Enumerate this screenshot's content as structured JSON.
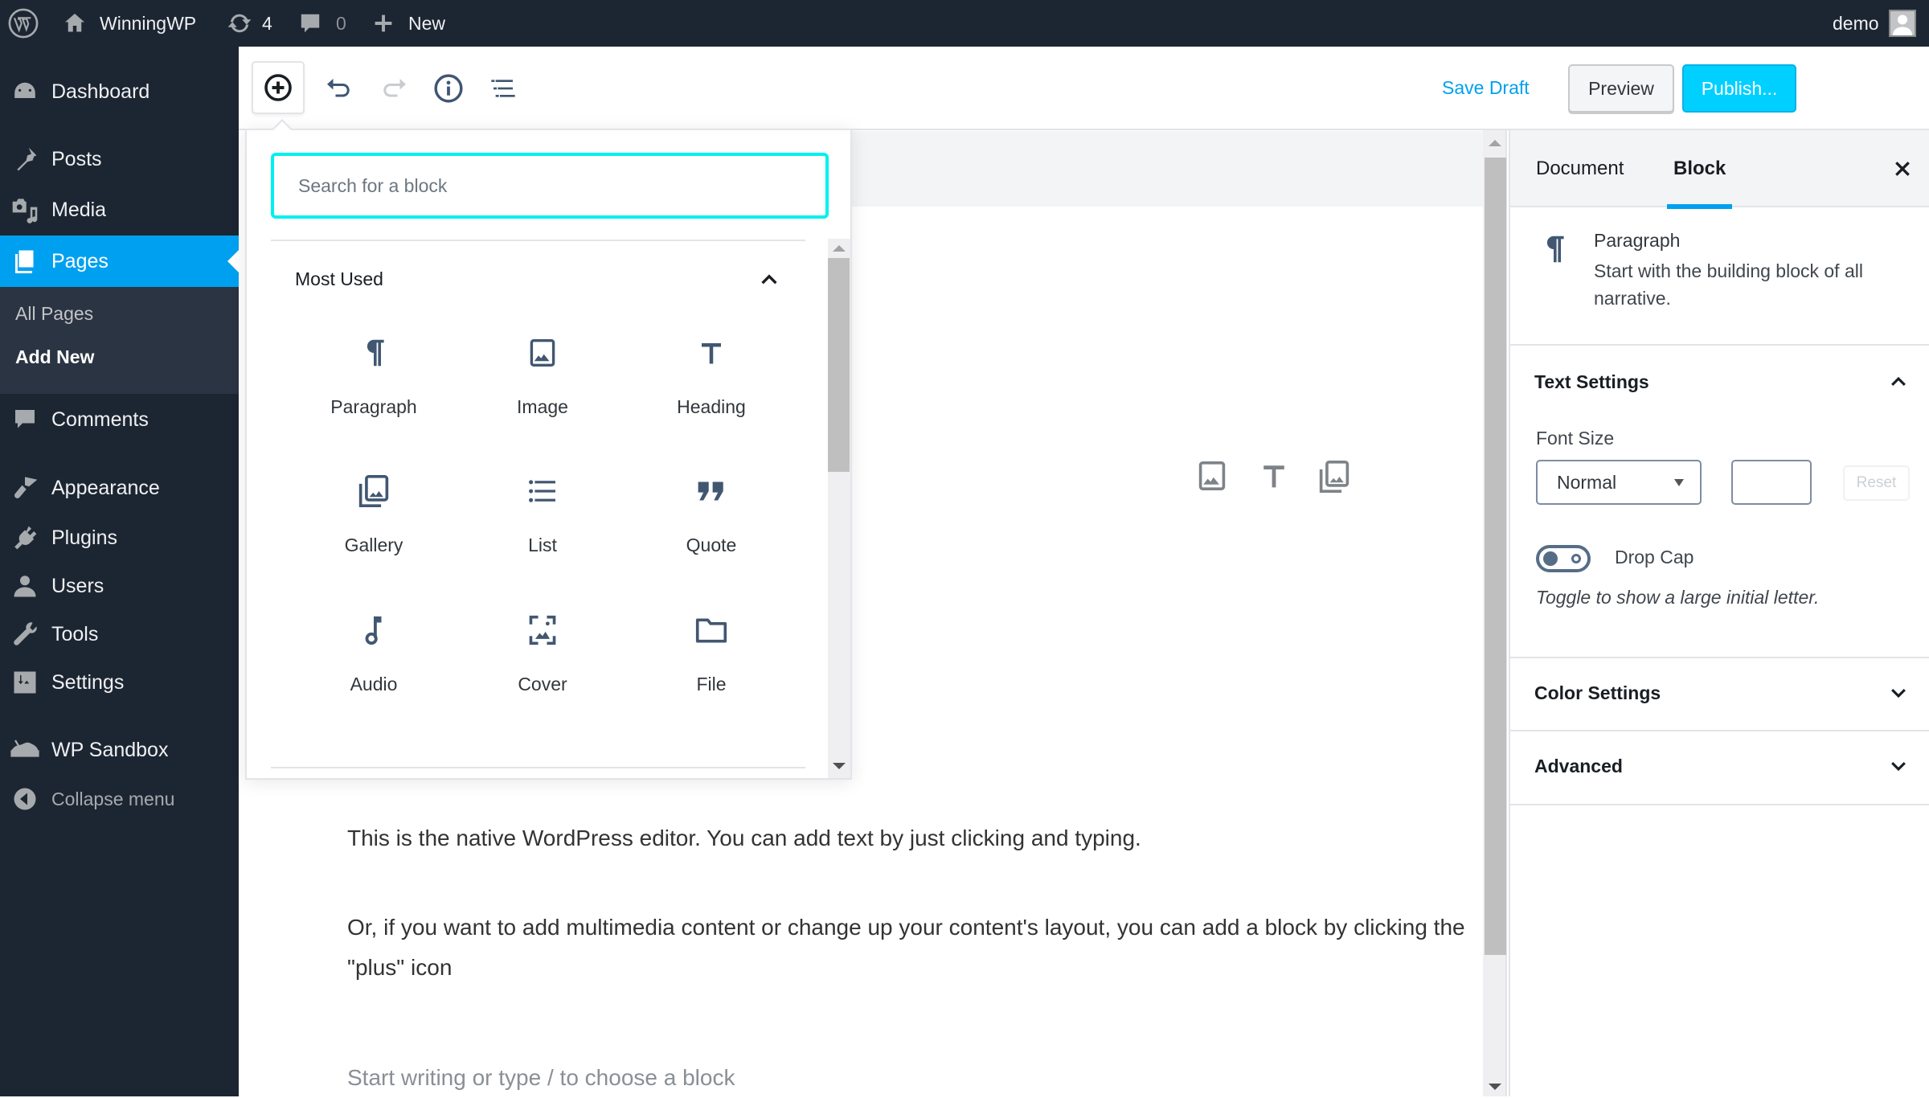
{
  "admin_bar": {
    "site_name": "WinningWP",
    "updates_count": "4",
    "comments_count": "0",
    "new_label": "New",
    "user_name": "demo"
  },
  "admin_menu": {
    "items": [
      {
        "label": "Dashboard",
        "icon": "dashboard-icon"
      },
      {
        "label": "Posts",
        "icon": "pin-icon"
      },
      {
        "label": "Media",
        "icon": "media-icon"
      },
      {
        "label": "Pages",
        "icon": "pages-icon",
        "active": true
      },
      {
        "label": "Comments",
        "icon": "comment-icon"
      },
      {
        "label": "Appearance",
        "icon": "paintbrush-icon"
      },
      {
        "label": "Plugins",
        "icon": "plugin-icon"
      },
      {
        "label": "Users",
        "icon": "user-icon"
      },
      {
        "label": "Tools",
        "icon": "wrench-icon"
      },
      {
        "label": "Settings",
        "icon": "settings-sliders-icon"
      },
      {
        "label": "WP Sandbox",
        "icon": "sandbox-icon"
      },
      {
        "label": "Collapse menu",
        "icon": "collapse-icon"
      }
    ],
    "submenu": [
      {
        "label": "All Pages"
      },
      {
        "label": "Add New",
        "current": true
      }
    ]
  },
  "toolbar": {
    "save_draft_label": "Save Draft",
    "preview_label": "Preview",
    "publish_label": "Publish...",
    "icons": [
      "add-block-icon",
      "undo-icon",
      "redo-icon",
      "info-icon",
      "outline-icon",
      "gear-icon",
      "more-vertical-icon"
    ]
  },
  "inserter": {
    "search_placeholder": "Search for a block",
    "category_label": "Most Used",
    "blocks": [
      {
        "label": "Paragraph",
        "icon": "paragraph-icon"
      },
      {
        "label": "Image",
        "icon": "image-icon"
      },
      {
        "label": "Heading",
        "icon": "heading-icon"
      },
      {
        "label": "Gallery",
        "icon": "gallery-icon"
      },
      {
        "label": "List",
        "icon": "list-icon"
      },
      {
        "label": "Quote",
        "icon": "quote-icon"
      },
      {
        "label": "Audio",
        "icon": "audio-icon"
      },
      {
        "label": "Cover",
        "icon": "cover-icon"
      },
      {
        "label": "File",
        "icon": "file-icon"
      }
    ]
  },
  "editor": {
    "paragraphs": [
      "This is the native WordPress editor. You can add text by just clicking and typing.",
      "Or, if you want to add multimedia content or change up your content's layout, you can add a block by clicking the \"plus\" icon"
    ],
    "placeholder": "Start writing or type / to choose a block",
    "quick_insert_icons": [
      "image-icon",
      "heading-icon",
      "gallery-icon"
    ]
  },
  "settings_sidebar": {
    "tabs": [
      {
        "label": "Document"
      },
      {
        "label": "Block",
        "active": true
      }
    ],
    "block_card": {
      "title": "Paragraph",
      "description": "Start with the building block of all narrative."
    },
    "text_settings": {
      "title": "Text Settings",
      "expanded": true,
      "font_size_label": "Font Size",
      "font_size_value": "Normal",
      "custom_size_value": "",
      "reset_label": "Reset",
      "drop_cap_label": "Drop Cap",
      "drop_cap_enabled": false,
      "drop_cap_help": "Toggle to show a large initial letter."
    },
    "color_settings": {
      "title": "Color Settings",
      "expanded": false
    },
    "advanced": {
      "title": "Advanced",
      "expanded": false
    }
  },
  "colors": {
    "admin_dark": "#1c2633",
    "accent_blue": "#00a0f0",
    "publish_bg": "#00d0ff",
    "settings_btn_bg": "#455a75",
    "search_focus": "#00f0f0"
  }
}
